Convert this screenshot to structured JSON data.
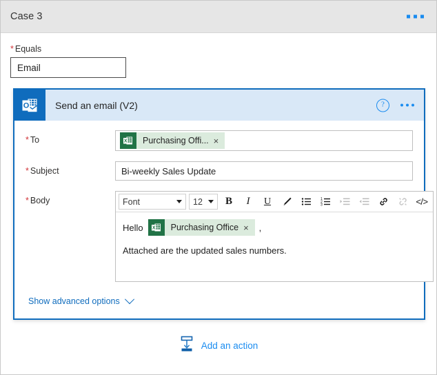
{
  "case_header": {
    "title": "Case 3",
    "menu_icon": "ellipsis-icon"
  },
  "condition": {
    "label": "Equals",
    "required_marker": "*",
    "value": "Email"
  },
  "action_card": {
    "icon": "outlook-icon",
    "title": "Send an email (V2)",
    "help_icon": "?",
    "menu_icon": "ellipsis-icon",
    "fields": {
      "to": {
        "label": "To",
        "required_marker": "*",
        "token": {
          "icon": "excel-icon",
          "label": "Purchasing Offi...",
          "remove_icon": "×"
        }
      },
      "subject": {
        "label": "Subject",
        "required_marker": "*",
        "value": "Bi-weekly Sales Update"
      },
      "body": {
        "label": "Body",
        "required_marker": "*",
        "toolbar": {
          "font_name": "Font",
          "font_size": "12",
          "bold": "B",
          "italic": "I",
          "underline": "U",
          "highlight_icon": "pen-icon",
          "bulleted_list_icon": "bulleted-list-icon",
          "numbered_list_icon": "numbered-list-icon",
          "increase_indent_icon": "increase-indent-icon",
          "decrease_indent_icon": "decrease-indent-icon",
          "link_icon": "link-icon",
          "unlink_icon": "unlink-icon",
          "code_view": "</>"
        },
        "content": {
          "greeting": "Hello",
          "token": {
            "icon": "excel-icon",
            "label": "Purchasing Office",
            "remove_icon": "×"
          },
          "comma": ",",
          "paragraph": "Attached are the updated sales numbers."
        }
      }
    },
    "advanced_options": {
      "label": "Show advanced options",
      "chevron_icon": "chevron-down-icon"
    }
  },
  "add_action": {
    "icon": "insert-action-icon",
    "label": "Add an action"
  },
  "colors": {
    "accent_blue": "#0f6cbd",
    "link_blue": "#1a8cf0",
    "card_header_blue": "#d9e8f7",
    "excel_green": "#217346",
    "token_green": "#dbebdd",
    "required_red": "#d13438",
    "case_header_gray": "#e6e6e6"
  }
}
